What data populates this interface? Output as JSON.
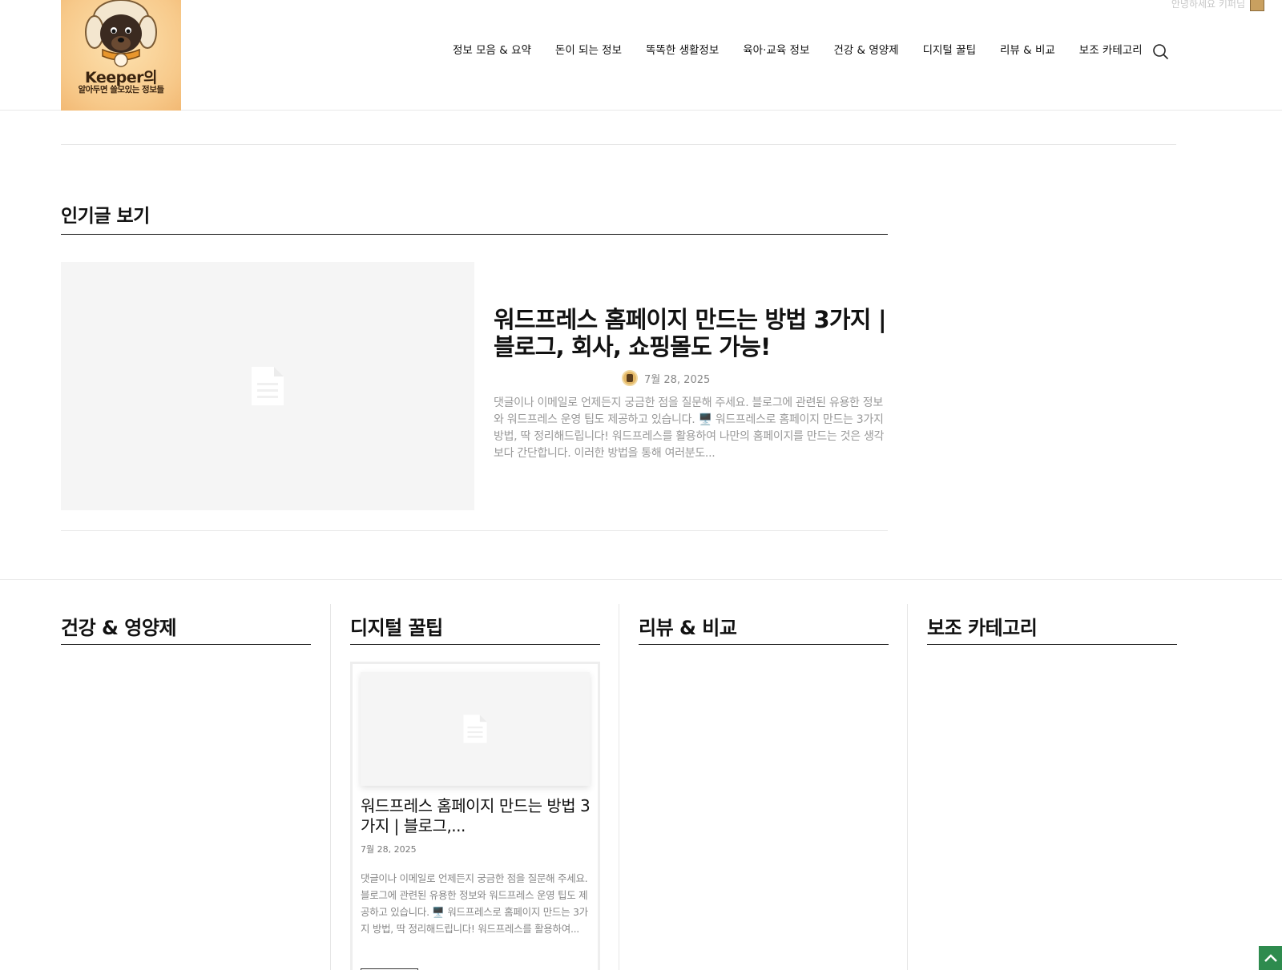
{
  "header": {
    "logo": {
      "title": "Keeper의",
      "subtitle": "알아두면 쓸모있는 정보들"
    },
    "topbar": {
      "greeting": "안녕하세요 키퍼님"
    },
    "nav": [
      "정보 모음 & 요약",
      "돈이 되는 정보",
      "똑똑한 생활정보",
      "육아·교육 정보",
      "건강 & 영양제",
      "디지털 꿀팁",
      "리뷰 & 비교",
      "보조 카테고리"
    ]
  },
  "popular": {
    "title": "인기글 보기",
    "post": {
      "title": "워드프레스 홈페이지 만드는 방법 3가지 | 블로그, 회사, 쇼핑몰도 가능!",
      "date": "7월 28, 2025",
      "excerpt": "댓글이나 이메일로 언제든지 궁금한 점을 질문해 주세요. 블로그에 관련된 유용한 정보와 워드프레스 운영 팁도 제공하고 있습니다. 🖥️ 워드프레스로 홈페이지 만드는 3가지 방법, 딱 정리해드립니다! 워드프레스를 활용하여 나만의 홈페이지를 만드는 것은 생각보다 간단합니다. 이러한 방법을 통해 여러분도..."
    }
  },
  "categories": [
    {
      "title": "건강 & 영양제"
    },
    {
      "title": "디지털 꿀팁"
    },
    {
      "title": "리뷰 & 비교"
    },
    {
      "title": "보조 카테고리"
    }
  ],
  "digital_card": {
    "title": "워드프레스 홈페이지 만드는 방법 3가지 | 블로그,...",
    "date": "7월 28, 2025",
    "excerpt": "댓글이나 이메일로 언제든지 궁금한 점을 질문해 주세요. 블로그에 관련된 유용한 정보와 워드프레스 운영 팁도 제공하고 있습니다. 🖥️ 워드프레스로 홈페이지 만드는 3가지 방법, 딱 정리해드립니다! 워드프레스를 활용하여..."
  },
  "colors": {
    "accent": "#2e8b4e",
    "placeholder": "#f5f5f5",
    "logo_bg": "#f7c98a"
  },
  "icons": {
    "search": "search-icon",
    "placeholder": "document-icon",
    "back_to_top": "chevron-up-icon"
  }
}
